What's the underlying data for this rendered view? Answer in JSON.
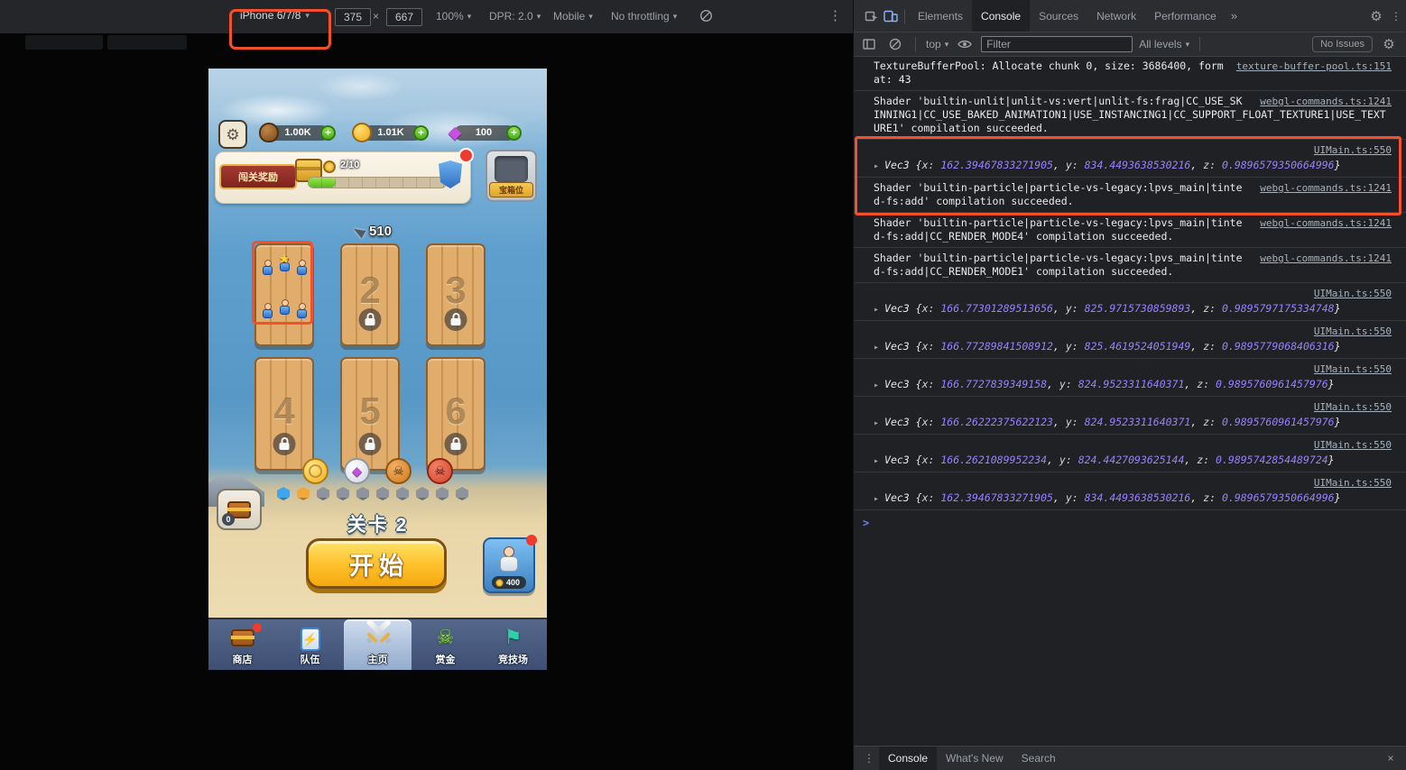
{
  "annotations": {
    "color": "#f4502c"
  },
  "emulation": {
    "device": "iPhone 6/7/8",
    "width": "375",
    "height": "667",
    "separator": "×",
    "zoom": "100%",
    "dpr": "DPR: 2.0",
    "device_type": "Mobile",
    "throttling": "No throttling"
  },
  "game": {
    "resources": [
      {
        "name": "wood",
        "value": "1.00K"
      },
      {
        "name": "coin",
        "value": "1.01K"
      },
      {
        "name": "gem",
        "value": "100"
      }
    ],
    "reward_panel": {
      "title": "闯关奖励",
      "progress_label": "2/10",
      "progress_percent": 20
    },
    "chest_slot_label": "宝箱位",
    "power_value": "510",
    "platforms": [
      {
        "has_units": true
      },
      {
        "label": "2",
        "locked": true
      },
      {
        "label": "3",
        "locked": true
      },
      {
        "label": "4",
        "locked": true
      },
      {
        "label": "5",
        "locked": true
      },
      {
        "label": "6",
        "locked": true
      }
    ],
    "medals": [
      "coin",
      "gem",
      "skull-bronze",
      "skull-red"
    ],
    "progress_dots": [
      "blue",
      "orange",
      "gray",
      "gray",
      "gray",
      "gray",
      "gray",
      "gray",
      "gray",
      "gray"
    ],
    "dot_colors": {
      "blue": "#3fa5ef",
      "orange": "#f2a93b",
      "gray": "#8d949d"
    },
    "chest_button_count": "0",
    "level_label": "关卡 2",
    "start_label": "开始",
    "card_price": "400",
    "nav": [
      {
        "label": "商店",
        "icon": "shop-chest"
      },
      {
        "label": "队伍",
        "icon": "team-card"
      },
      {
        "label": "主页",
        "icon": "home-swords",
        "active": true
      },
      {
        "label": "赏金",
        "icon": "bounty-skull"
      },
      {
        "label": "竞技场",
        "icon": "arena-flag"
      }
    ],
    "glyphs": {
      "bolt": "⚡",
      "skull": "☠",
      "flag": "⚑",
      "star": "★",
      "gem": "◆"
    }
  },
  "devtools": {
    "tabs": [
      {
        "label": "Elements"
      },
      {
        "label": "Console",
        "active": true
      },
      {
        "label": "Sources"
      },
      {
        "label": "Network"
      },
      {
        "label": "Performance"
      }
    ],
    "more_tabs": "»",
    "prompt": ">",
    "console_toolbar": {
      "context": "top",
      "filter_placeholder": "Filter",
      "levels": "All levels",
      "issues": "No Issues"
    },
    "messages": [
      {
        "type": "text",
        "text": "TextureBufferPool: Allocate chunk 0, size: 3686400, format: 43",
        "link": "texture-buffer-pool.ts:151"
      },
      {
        "type": "text",
        "text": "Shader 'builtin-unlit|unlit-vs:vert|unlit-fs:frag|CC_USE_SKINNING1|CC_USE_BAKED_ANIMATION1|USE_INSTANCING1|CC_SUPPORT_FLOAT_TEXTURE1|USE_TEXTURE1' compilation succeeded.",
        "link": "webgl-commands.ts:1241"
      },
      {
        "type": "vec3",
        "class": "Vec3",
        "x": "162.39467833271905",
        "y": "834.4493638530216",
        "z": "0.9896579350664996",
        "link": "UIMain.ts:550"
      },
      {
        "type": "text",
        "text": "Shader 'builtin-particle|particle-vs-legacy:lpvs_main|tinted-fs:add' compilation succeeded.",
        "link": "webgl-commands.ts:1241"
      },
      {
        "type": "text",
        "text": "Shader 'builtin-particle|particle-vs-legacy:lpvs_main|tinted-fs:add|CC_RENDER_MODE4' compilation succeeded.",
        "link": "webgl-commands.ts:1241"
      },
      {
        "type": "text",
        "text": "Shader 'builtin-particle|particle-vs-legacy:lpvs_main|tinted-fs:add|CC_RENDER_MODE1' compilation succeeded.",
        "link": "webgl-commands.ts:1241"
      },
      {
        "type": "vec3",
        "class": "Vec3",
        "x": "166.77301289513656",
        "y": "825.9715730859893",
        "z": "0.9895797175334748",
        "link": "UIMain.ts:550"
      },
      {
        "type": "vec3",
        "class": "Vec3",
        "x": "166.77289841508912",
        "y": "825.4619524051949",
        "z": "0.9895779068406316",
        "link": "UIMain.ts:550"
      },
      {
        "type": "vec3",
        "class": "Vec3",
        "x": "166.7727839349158",
        "y": "824.9523311640371",
        "z": "0.9895760961457976",
        "link": "UIMain.ts:550"
      },
      {
        "type": "vec3",
        "class": "Vec3",
        "x": "166.26222375622123",
        "y": "824.9523311640371",
        "z": "0.9895760961457976",
        "link": "UIMain.ts:550"
      },
      {
        "type": "vec3",
        "class": "Vec3",
        "x": "166.2621089952234",
        "y": "824.4427093625144",
        "z": "0.9895742854489724",
        "link": "UIMain.ts:550"
      },
      {
        "type": "vec3",
        "class": "Vec3",
        "x": "162.39467833271905",
        "y": "834.4493638530216",
        "z": "0.9896579350664996",
        "link": "UIMain.ts:550"
      }
    ],
    "drawer_tabs": [
      {
        "label": "Console",
        "active": true
      },
      {
        "label": "What's New"
      },
      {
        "label": "Search"
      }
    ]
  }
}
